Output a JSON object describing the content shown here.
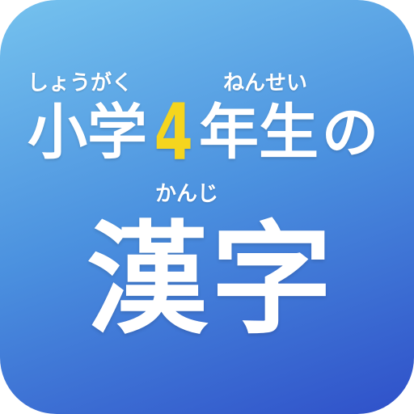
{
  "icon": {
    "ruby_shogaku": "しょうがく",
    "ruby_nensei": "ねんせい",
    "ruby_kanji": "かんじ",
    "title_part1": "小学",
    "title_grade": "4",
    "title_part2": "年生",
    "title_particle": "の",
    "main_word": "漢字",
    "colors": {
      "gradient_top": "#75c2ee",
      "gradient_bottom": "#2f50c9",
      "grade_number": "#f5d51e",
      "text": "#ffffff"
    }
  }
}
